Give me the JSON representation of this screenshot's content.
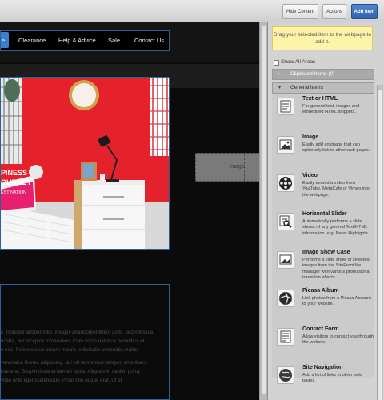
{
  "toolbar": {
    "hide_content": "Hide Content",
    "actions": "Actions",
    "add_item": "Add Item"
  },
  "site": {
    "nav": [
      "e",
      "Clearance",
      "Help & Advice",
      "Sale",
      "Contact Us"
    ],
    "hero_text": {
      "line1": "PINESS",
      "line2": "OURNEY",
      "line3": "ESTINATION"
    },
    "paragraphs": [
      "c, molestie tempor odio. Integer ullamcorper libero justo, sed vehicula",
      "nostra, per inceptos himenaeos. Cum sociis natoque penatibus et",
      "o nec. Pellentesque ornare mauris sollicitudin venenatis mattis.",
      "venenatis. Donec adipiscing, dui vel fermentum tempor, ante libero",
      "inar erat. Suspendisse et laoreet ligula. Aliquam in sapien porta,",
      "vitae ante eget scelerisque. Proin non augue erat. Ut et"
    ]
  },
  "drop_placeholder": {
    "label": "Image"
  },
  "panel": {
    "hint": "Drag your selected item to the webpage to add it.",
    "show_all_areas": "Show All Areas",
    "clipboard": "Clipboard Items (0)",
    "general": "General Items",
    "items": [
      {
        "title": "Text or HTML",
        "desc": "For general text, images and embedded HTML snippets.",
        "icon": "text-html-icon"
      },
      {
        "title": "Image",
        "desc": "Easily add an image that can optionally link to other web pages.",
        "icon": "image-icon"
      },
      {
        "title": "Video",
        "desc": "Easily embed a video from YouTube, MetaCafe or Vimeo into the webpage.",
        "icon": "video-icon"
      },
      {
        "title": "Horizontal Slider",
        "desc": "Automatically performs a slide shows of any general Text/HTML information. e.g. News Highlights.",
        "icon": "slider-icon"
      },
      {
        "title": "Image Show Case",
        "desc": "Performs a slide show of selected images from the SiteFront file manager with various professional transition effects.",
        "icon": "showcase-icon"
      },
      {
        "title": "Picasa Album",
        "desc": "Link photos from a Picasa Account to your website.",
        "icon": "picasa-icon"
      },
      {
        "title": "Contact Form",
        "desc": "Allow visitors to contact you through the website.",
        "icon": "contact-form-icon"
      },
      {
        "title": "Site Navigation",
        "desc": "Add a list of links to other web pages.",
        "icon": "site-navigation-icon"
      }
    ]
  },
  "colors": {
    "accent": "#3b80c9",
    "hint_bg": "#fdf4a9",
    "red_wall": "#e5222b"
  }
}
